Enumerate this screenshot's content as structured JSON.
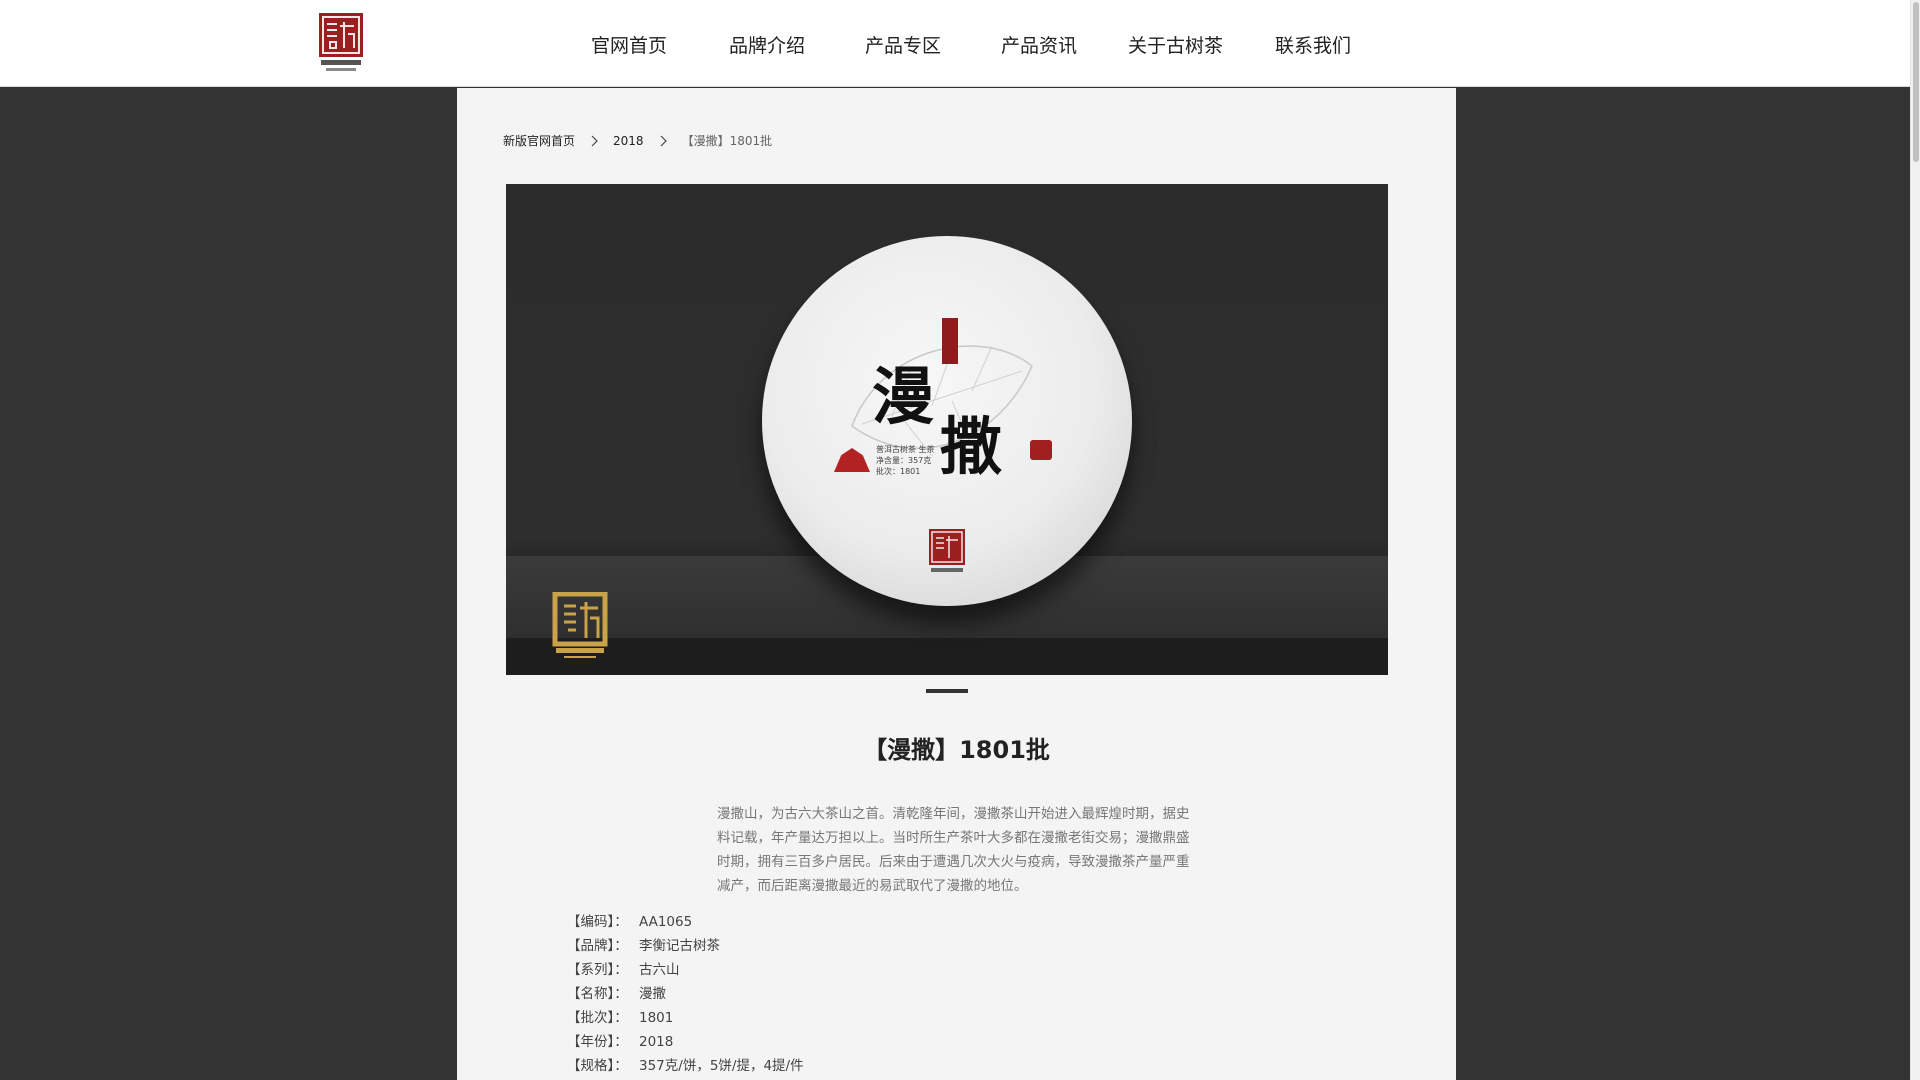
{
  "header": {
    "logo_alt": "李衡记古树茶",
    "nav": [
      {
        "label": "官网首页"
      },
      {
        "label": "品牌介绍"
      },
      {
        "label": "产品专区"
      },
      {
        "label": "产品资讯"
      },
      {
        "label": "关于古树茶"
      },
      {
        "label": "联系我们"
      }
    ]
  },
  "breadcrumb": {
    "items": [
      "新版官网首页",
      "2018",
      "【漫撒】1801批"
    ]
  },
  "hero": {
    "cake_title_1": "漫",
    "cake_title_2": "撒",
    "cake_info": [
      "普洱古树茶 生茶",
      "净含量：357克",
      "批次：1801"
    ],
    "cake_mark": "普洱"
  },
  "product": {
    "title": "【漫撒】1801批",
    "description": "漫撒山，为古六大茶山之首。清乾隆年间，漫撒茶山开始进入最辉煌时期，据史料记载，年产量达万担以上。当时所生产茶叶大多都在漫撒老街交易；漫撒鼎盛时期，拥有三百多户居民。后来由于遭遇几次大火与疫病，导致漫撒茶产量严重减产，而后距离漫撒最近的易武取代了漫撒的地位。",
    "specs": [
      {
        "key": "【编码】：",
        "value": "AA1065"
      },
      {
        "key": "【品牌】：",
        "value": "李衡记古树茶"
      },
      {
        "key": "【系列】：",
        "value": "古六山"
      },
      {
        "key": "【名称】：",
        "value": "漫撒"
      },
      {
        "key": "【批次】：",
        "value": "1801"
      },
      {
        "key": "【年份】：",
        "value": "2018"
      },
      {
        "key": "【规格】：",
        "value": "357克/饼，5饼/提，4提/件"
      }
    ]
  },
  "colors": {
    "page_bg": "#333333",
    "panel_bg": "#f4f4f4",
    "brand_red": "#8e1c1c",
    "gold": "#c9a24a"
  }
}
